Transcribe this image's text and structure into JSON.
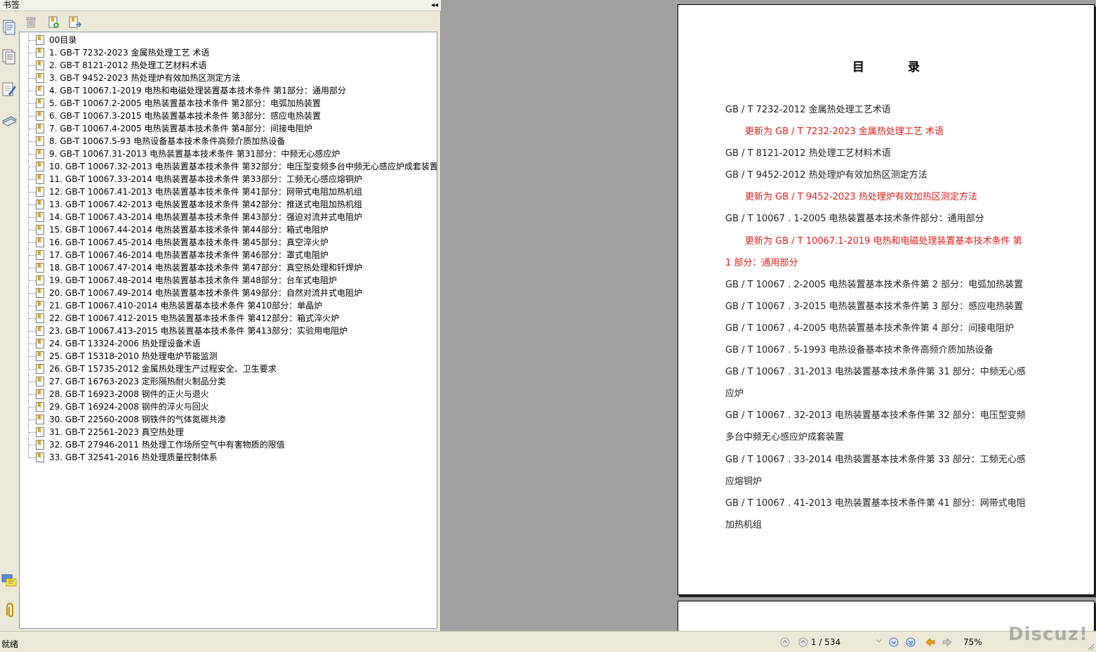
{
  "panel": {
    "title": "书签",
    "collapse_glyph": "◂◂"
  },
  "toolbar": {
    "icons": [
      "delete-bookmark-icon",
      "new-bookmark-icon",
      "expand-bookmark-icon"
    ]
  },
  "side_icons": [
    "pages-icon",
    "layers-icon",
    "signatures-icon",
    "attachments-list-icon",
    "comments-icon",
    "paperclip-icon"
  ],
  "bookmarks": [
    "00目录",
    "1. GB-T 7232-2023 金属热处理工艺 术语",
    "2. GB-T 8121-2012 热处理工艺材料术语",
    "3. GB-T 9452-2023 热处理炉有效加热区测定方法",
    "4. GB-T 10067.1-2019 电热和电磁处理装置基本技术条件 第1部分：通用部分",
    "5. GB-T 10067.2-2005 电热装置基本技术条件 第2部分：电弧加热装置",
    "6. GB-T 10067.3-2015 电热装置基本技术条件 第3部分：感应电热装置",
    "7. GB-T 10067.4-2005 电热装置基本技术条件 第4部分：间接电阻炉",
    "8. GB-T 10067.5-93 电热设备基本技术条件高频介质加热设备",
    "9. GB-T 10067.31-2013 电热装置基本技术条件 第31部分：中频无心感应炉",
    "10. GB-T 10067.32-2013 电热装置基本技术条件 第32部分：电压型变频多台中频无心感应炉成套装置",
    "11. GB-T 10067.33-2014 电热装置基本技术条件 第33部分：工频无心感应熔铜炉",
    "12. GB-T 10067.41-2013 电热装置基本技术条件 第41部分：网带式电阻加热机组",
    "13. GB-T 10067.42-2013 电热装置基本技术条件 第42部分：推送式电阻加热机组",
    "14. GB-T 10067.43-2014 电热装置基本技术条件 第43部分：强迫对流井式电阻炉",
    "15. GB-T 10067.44-2014 电热装置基本技术条件 第44部分：箱式电阻炉",
    "16. GB-T 10067.45-2014 电热装置基本技术条件 第45部分：真空淬火炉",
    "17. GB-T 10067.46-2014 电热装置基本技术条件 第46部分：罩式电阻炉",
    "18. GB-T 10067.47-2014 电热装置基本技术条件 第47部分：真空热处理和钎焊炉",
    "19. GB-T 10067.48-2014 电热装置基本技术条件 第48部分：台车式电阻炉",
    "20. GB-T 10067.49-2014 电热装置基本技术条件 第49部分：自然对流井式电阻炉",
    "21. GB-T 10067.410-2014 电热装置基本技术条件 第410部分：单晶炉",
    "22. GB-T 10067.412-2015 电热装置基本技术条件 第412部分：箱式淬火炉",
    "23. GB-T 10067.413-2015 电热装置基本技术条件 第413部分：实验用电阻炉",
    "24. GB-T 13324-2006 热处理设备术语",
    "25. GB-T 15318-2010 热处理电炉节能监测",
    "26. GB-T 15735-2012 金属热处理生产过程安全、卫生要求",
    "27. GB-T 16763-2023 定形隔热耐火制品分类",
    "28. GB-T 16923-2008 钢件的正火与退火",
    "29. GB-T 16924-2008 钢件的淬火与回火",
    "30. GB-T 22560-2008 钢铁件的气体氮碳共渗",
    "31. GB-T 22561-2023 真空热处理",
    "32. GB-T 27946-2011 热处理工作场所空气中有害物质的限值",
    "33. GB-T 32541-2016 热处理质量控制体系"
  ],
  "document": {
    "toc_title": "目 录",
    "lines": [
      {
        "text": "GB / T 7232-2012 金属热处理工艺术语",
        "style": "normal"
      },
      {
        "text": "更新为 GB / T 7232-2023  金属热处理工艺  术语",
        "style": "red"
      },
      {
        "text": "GB / T 8121-2012 热处理工艺材料术语",
        "style": "normal"
      },
      {
        "text": "GB / T 9452-2012 热处理炉有效加热区测定方法",
        "style": "normal"
      },
      {
        "text": "更新为 GB / T 9452-2023  热处理炉有效加热区测定方法",
        "style": "red"
      },
      {
        "text": "GB / T 10067 . 1-2005 电热装置基本技术条件部分：通用部分",
        "style": "normal"
      },
      {
        "text": "更新为 GB / T 10067.1-2019  电热和电磁处理装置基本技术条件  第",
        "style": "red"
      },
      {
        "text": "1 部分：通用部分",
        "style": "red-cont"
      },
      {
        "text": "GB / T 10067 . 2-2005 电热装置基本技术条件第 2 部分：电弧加热装置",
        "style": "normal"
      },
      {
        "text": "GB / T 10067 . 3-2015 电热装置基本技术条件第 3 部分：感应电热装置",
        "style": "normal"
      },
      {
        "text": "GB / T 10067 . 4-2005 电热装置基本技术条件第 4 部分：间接电阻炉",
        "style": "normal"
      },
      {
        "text": "GB / T 10067 . 5-1993 电热设备基本技术条件高频介质加热设备",
        "style": "normal"
      },
      {
        "text": "GB / T 10067 . 31-2013 电热装置基本技术条件第 31 部分：中频无心感",
        "style": "normal"
      },
      {
        "text": "应炉",
        "style": "normal"
      },
      {
        "text": "GB / T 10067 . 32-2013 电热装置基本技术条件第 32 部分：电压型变频",
        "style": "normal"
      },
      {
        "text": "多台中频无心感应炉成套装置",
        "style": "normal"
      },
      {
        "text": "GB / T 10067 . 33-2014 电热装置基本技术条件第 33 部分：工频无心感",
        "style": "normal"
      },
      {
        "text": "应熔铜炉",
        "style": "normal"
      },
      {
        "text": "GB / T 10067 . 41-2013 电热装置基本技术条件第 41 部分：网带式电阻",
        "style": "normal"
      },
      {
        "text": "加热机组",
        "style": "normal"
      }
    ]
  },
  "statusbar": {
    "status": "就绪",
    "page_indicator": "1 / 534",
    "zoom": "75%",
    "watermark": "Discuz!"
  },
  "colors": {
    "accent_red": "#e0201b",
    "panel_bg": "#ece9d8",
    "doc_bg": "#a0a0a0"
  }
}
